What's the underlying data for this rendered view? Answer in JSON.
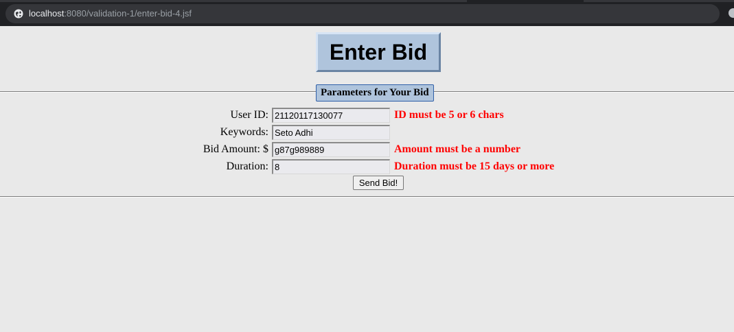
{
  "browser": {
    "url_host": "localhost",
    "url_path": ":8080/validation-1/enter-bid-4.jsf"
  },
  "page": {
    "title": "Enter Bid",
    "legend": "Parameters for Your Bid",
    "fields": [
      {
        "label": "User ID:",
        "value": "21120117130077",
        "error": "ID must be 5 or 6 chars"
      },
      {
        "label": "Keywords:",
        "value": "Seto Adhi",
        "error": ""
      },
      {
        "label": "Bid Amount: $",
        "value": "g87g989889",
        "error": "Amount must be a number"
      },
      {
        "label": "Duration:",
        "value": "8",
        "error": "Duration must be 15 days or more"
      }
    ],
    "submit_label": "Send Bid!"
  },
  "colors": {
    "error": "#ff0000",
    "title_bg": "#afc4dc",
    "page_bg": "#e9e9e9"
  }
}
